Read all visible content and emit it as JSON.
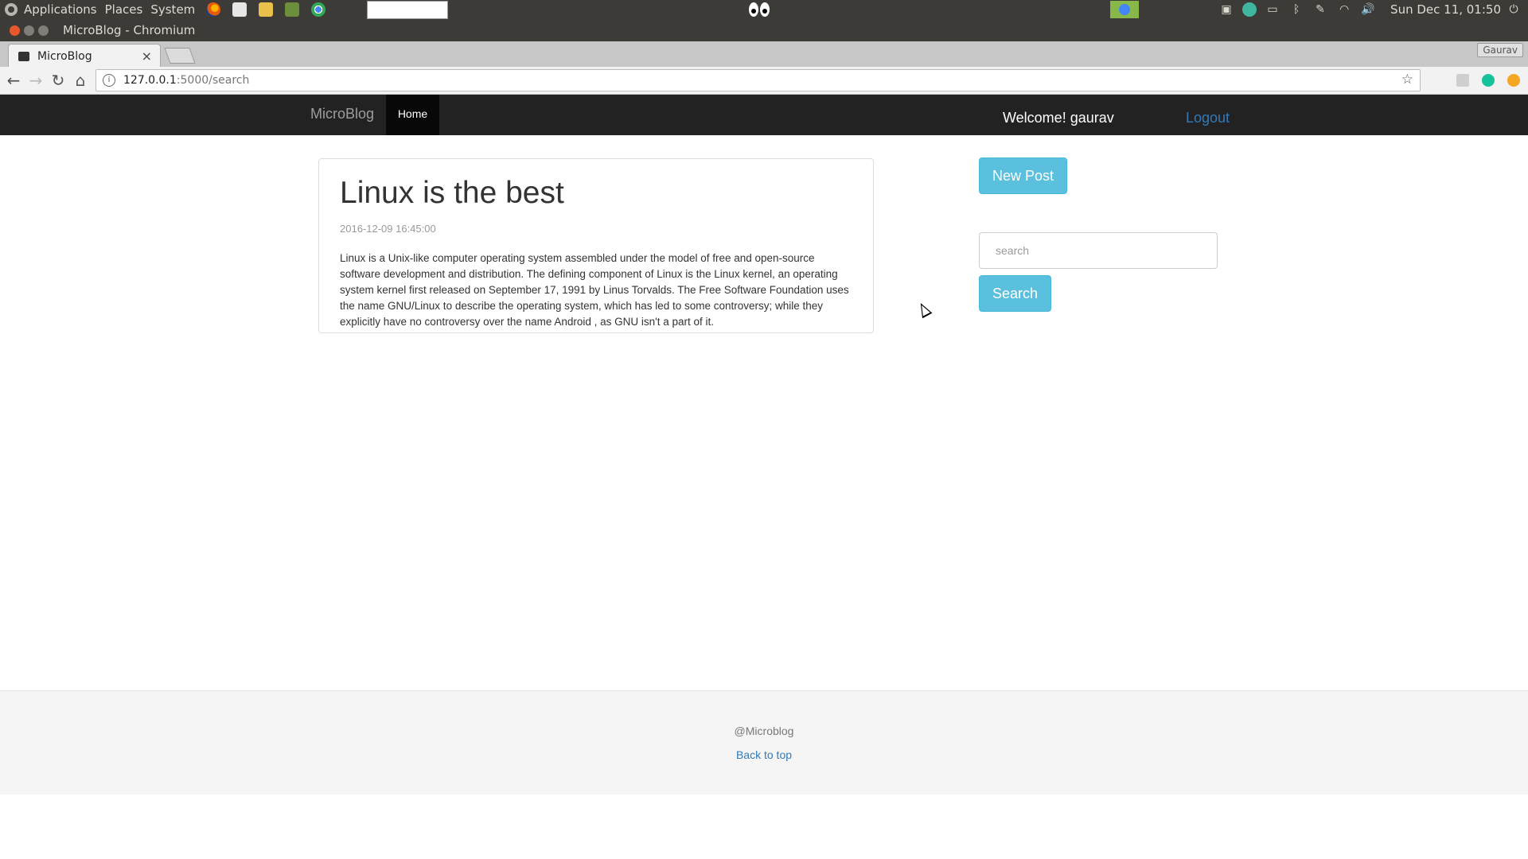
{
  "os_panel": {
    "menu": [
      "Applications",
      "Places",
      "System"
    ],
    "launchers": [
      "firefox-icon",
      "system-settings-icon",
      "folder-icon",
      "terminal-icon",
      "chromium-icon",
      "document-icon"
    ],
    "clock": "Sun Dec 11, 01:50"
  },
  "window": {
    "title": "MicroBlog - Chromium"
  },
  "browser": {
    "tab_title": "MicroBlog",
    "profile": "Gaurav",
    "url_host": "127.0.0.1",
    "url_path": ":5000/search"
  },
  "site": {
    "brand": "MicroBlog",
    "nav_home": "Home",
    "welcome": "Welcome! gaurav",
    "logout": "Logout"
  },
  "post": {
    "title": "Linux is the best",
    "date": "2016-12-09 16:45:00",
    "body": "Linux is a Unix-like computer operating system assembled under the model of free and open-source software development and distribution. The defining component of Linux is the Linux kernel, an operating system kernel first released on September 17, 1991 by Linus Torvalds. The Free Software Foundation uses the name GNU/Linux to describe the operating system, which has led to some controversy; while they explicitly have no controversy over the name Android , as GNU isn't a part of it."
  },
  "sidebar": {
    "new_post": "New Post",
    "search_placeholder": "search",
    "search_button": "Search"
  },
  "footer": {
    "copyright": "@Microblog",
    "back_to_top": "Back to top"
  },
  "colors": {
    "navbar": "#222222",
    "accent_button": "#5bc0de",
    "link": "#337ab7"
  }
}
